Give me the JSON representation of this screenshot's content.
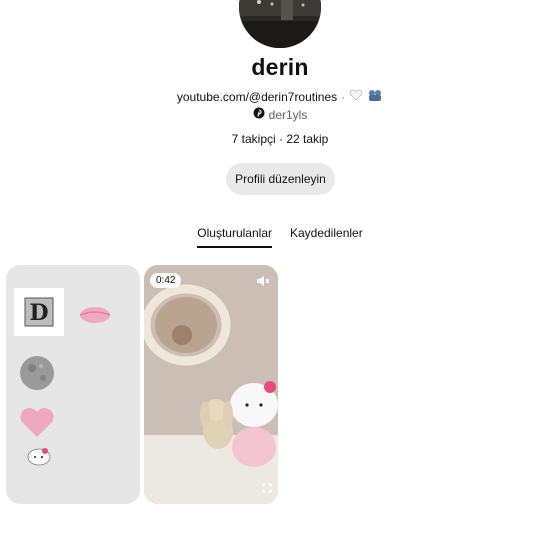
{
  "profile": {
    "name": "derin",
    "youtube": "youtube.com/@derin7routines",
    "separator": "·",
    "pinterest_handle": "der1yls",
    "follow_text": "7 takipçi · 22 takip",
    "edit_button": "Profili düzenleyin"
  },
  "tabs": [
    {
      "label": "Oluşturulanlar",
      "active": true
    },
    {
      "label": "Kaydedilenler",
      "active": false
    }
  ],
  "pins": {
    "video_duration": "0:42",
    "board_letter": "D"
  },
  "icons": {
    "emoji_heart": "white-heart-icon",
    "emoji_bear": "bears-icon",
    "pinterest": "pinterest-icon",
    "mute": "speaker-mute-icon",
    "expand": "expand-icon"
  },
  "colors": {
    "accent": "#e60023",
    "button_bg": "#e9e9e9",
    "board_bg": "#e6e6e6"
  }
}
